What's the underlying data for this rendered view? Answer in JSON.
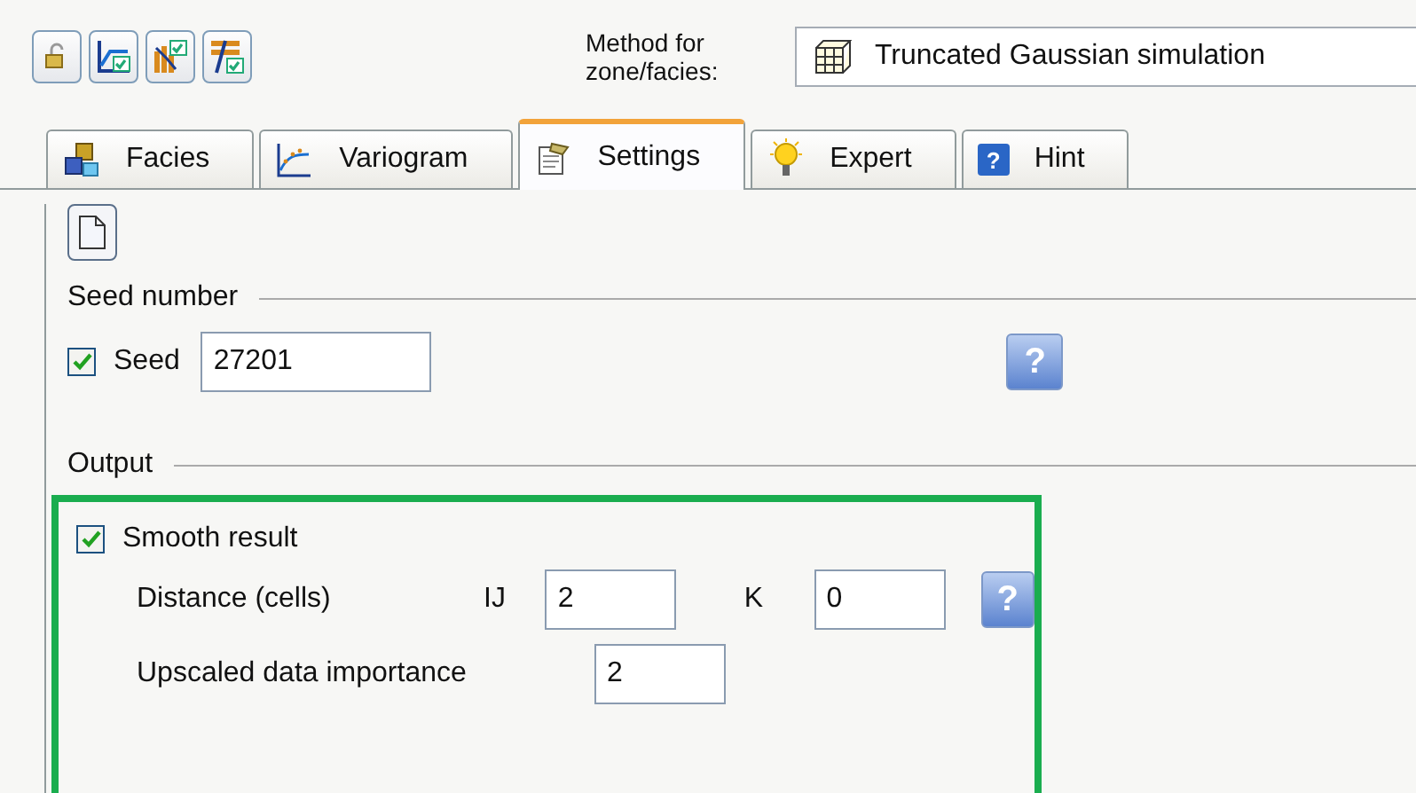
{
  "toolbar": {
    "buttons": [
      {
        "kind": "lock"
      },
      {
        "kind": "chart-check"
      },
      {
        "kind": "bars-check"
      },
      {
        "kind": "layers-check"
      }
    ]
  },
  "method": {
    "label_lines": [
      "Method for",
      "zone/facies:"
    ],
    "value": "Truncated Gaussian simulation"
  },
  "tabs": [
    {
      "label": "Facies",
      "selected": false,
      "kind": "facies"
    },
    {
      "label": "Variogram",
      "selected": false,
      "kind": "variogram"
    },
    {
      "label": "Settings",
      "selected": true,
      "kind": "settings"
    },
    {
      "label": "Expert",
      "selected": false,
      "kind": "expert"
    },
    {
      "label": "Hint",
      "selected": false,
      "kind": "hint",
      "badge": "?"
    }
  ],
  "settings": {
    "seed_section": {
      "title": "Seed number"
    },
    "seed": {
      "label": "Seed",
      "checked": true,
      "value": "27201",
      "help": "?"
    },
    "output_section": {
      "title": "Output",
      "highlighted": true
    },
    "smooth": {
      "label": "Smooth result",
      "checked": true
    },
    "distance": {
      "label": "Distance (cells)",
      "ij_label": "IJ",
      "ij_value": "2",
      "k_label": "K",
      "k_value": "0",
      "help": "?"
    },
    "upscaled": {
      "label": "Upscaled data importance",
      "value": "2"
    }
  }
}
